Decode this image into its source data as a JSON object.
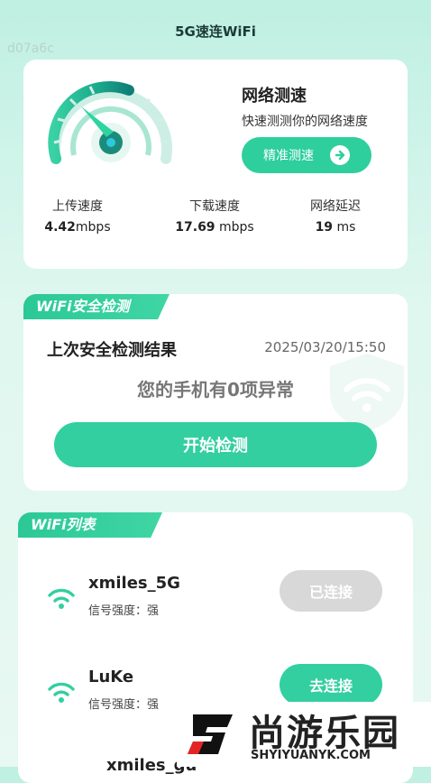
{
  "app": {
    "title": "5G速连WiFi",
    "watermark_code": "d07a6c"
  },
  "speed_test": {
    "title": "网络测速",
    "subtitle": "快速测测你的网络速度",
    "button_label": "精准测速",
    "stats": [
      {
        "label": "上传速度",
        "value": "4.42",
        "unit": "mbps"
      },
      {
        "label": "下载速度",
        "value": "17.69",
        "unit": " mbps"
      },
      {
        "label": "网络延迟",
        "value": "19",
        "unit": " ms"
      }
    ]
  },
  "security": {
    "ribbon": "WiFi安全检测",
    "last_result_label": "上次安全检测结果",
    "last_result_time": "2025/03/20/15:50",
    "abnormal_text": "您的手机有0项异常",
    "start_button": "开始检测"
  },
  "wifi_list": {
    "ribbon": "WiFi列表",
    "networks": [
      {
        "ssid": "xmiles_5G",
        "signal": "信号强度：强",
        "action": "已连接",
        "connected": true
      },
      {
        "ssid": "LuKe",
        "signal": "信号强度：强",
        "action": "去连接",
        "connected": false
      }
    ],
    "partial_ssid": "xmiles_gu"
  },
  "site_logo": {
    "name": "尚游乐园",
    "url": "SHYIYUANYK.COM"
  },
  "colors": {
    "accent": "#33cfa0",
    "gauge_dark": "#1b8c7a",
    "disabled": "#d8d8d8"
  }
}
